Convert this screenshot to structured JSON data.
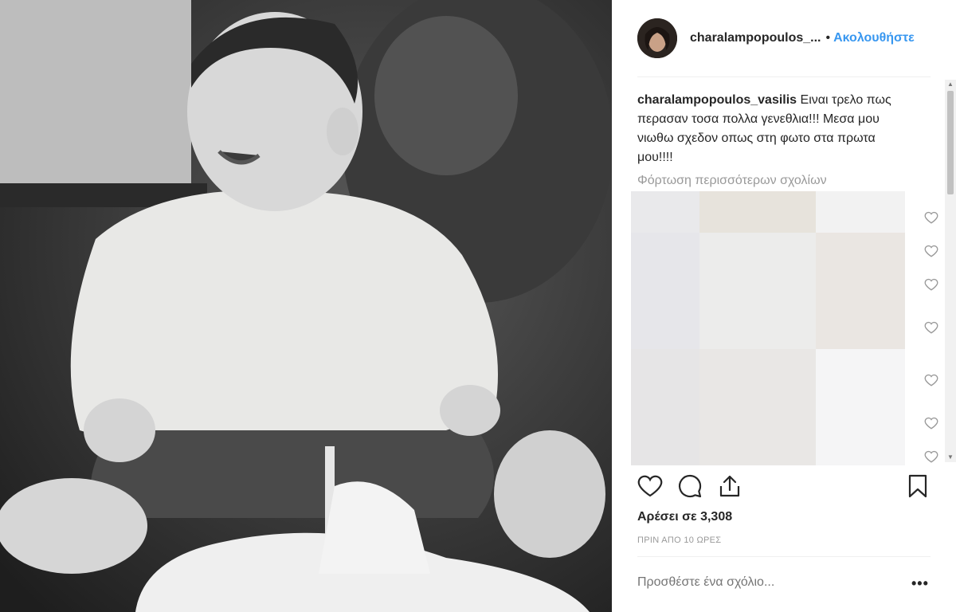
{
  "post": {
    "photo_description_icon": "baby-birthday-photo",
    "header": {
      "username": "charalampopoulos_...",
      "separator": "•",
      "follow_label": "Ακολουθήστε"
    },
    "caption": {
      "username": "charalampopoulos_vasilis",
      "text": "Ειναι τρελο πως περασαν τοσα πολλα γενεθλια!!! Μεσα μου νιωθω σχεδον οπως στη φωτο στα πρωτα μου!!!!"
    },
    "load_more_comments": "Φόρτωση περισσότερων σχολίων",
    "likes": "Αρέσει σε 3,308",
    "time": "ΠΡΙΝ ΑΠΟ 10 ΩΡΕΣ",
    "comment_input": {
      "placeholder": "Προσθέστε ένα σχόλιο..."
    },
    "more_label": "•••"
  },
  "colors": {
    "link": "#3897f0",
    "text": "#262626",
    "muted": "#999999"
  }
}
